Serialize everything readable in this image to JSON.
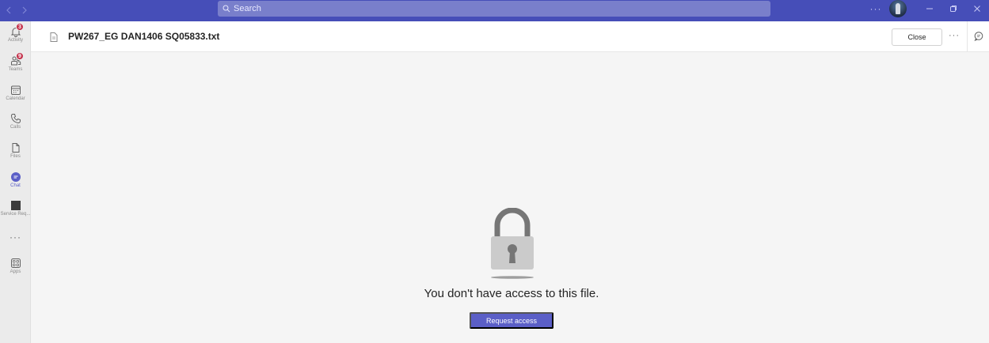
{
  "titlebar": {
    "search_placeholder": "Search",
    "more_label": "···",
    "accent": "#464eb8"
  },
  "rail": {
    "items": [
      {
        "label": "Activity",
        "badge": "3",
        "icon": "bell-icon"
      },
      {
        "label": "Teams",
        "badge": "9",
        "icon": "teams-icon"
      },
      {
        "label": "Calendar",
        "icon": "calendar-icon"
      },
      {
        "label": "Calls",
        "icon": "phone-icon"
      },
      {
        "label": "Files",
        "icon": "file-icon"
      },
      {
        "label": "Chat",
        "icon": "chat-icon",
        "active": true
      },
      {
        "label": "Service Req...",
        "icon": "app-tile-icon"
      },
      {
        "label": "Apps",
        "icon": "apps-icon"
      }
    ],
    "more_label": "···"
  },
  "header": {
    "file_title": "PW267_EG DAN1406 SQ05833.txt",
    "close_label": "Close",
    "more_label": "···"
  },
  "main": {
    "message": "You don't have access to this file.",
    "request_label": "Request access",
    "button_color": "#5b5fc7"
  }
}
